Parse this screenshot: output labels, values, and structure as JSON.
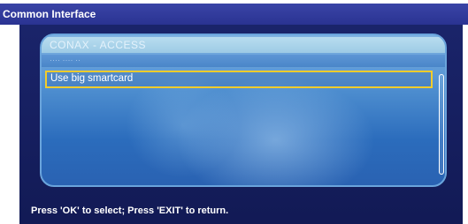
{
  "window": {
    "title": "Common Interface"
  },
  "panel": {
    "header": "CONAX - ACCESS",
    "subheader": "···· ···· ··",
    "items": [
      {
        "label": "Use big smartcard",
        "selected": true
      }
    ]
  },
  "footer": {
    "hint": "Press 'OK' to select; Press 'EXIT' to return."
  },
  "colors": {
    "title_bar": "#2f3a9e",
    "frame": "#1a246a",
    "panel_top": "#7fb3e3",
    "panel_bottom": "#2a62b2",
    "selection_border": "#f2cc2b"
  }
}
